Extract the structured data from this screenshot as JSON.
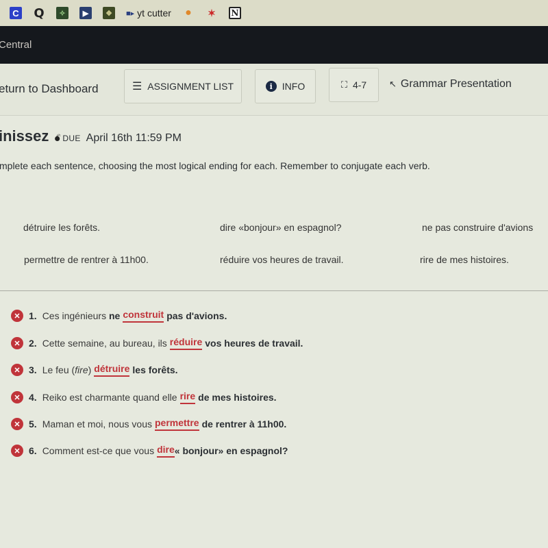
{
  "bookmarks": [
    {
      "icon": "c-app-icon",
      "glyph": "C"
    },
    {
      "icon": "q-app-icon",
      "glyph": "Q"
    },
    {
      "icon": "green-app-icon",
      "glyph": "✧"
    },
    {
      "icon": "play-app-icon",
      "glyph": "▶"
    },
    {
      "icon": "game-app-icon",
      "glyph": "❖"
    },
    {
      "icon": "yt-cutter-icon",
      "glyph": "■▸",
      "label": "yt cutter"
    },
    {
      "icon": "lightbulb-icon",
      "glyph": "●"
    },
    {
      "icon": "crossed-icon",
      "glyph": "✶"
    },
    {
      "icon": "notion-icon",
      "glyph": "N"
    }
  ],
  "app": {
    "title": "Central"
  },
  "toolbar": {
    "back_label": "eturn to Dashboard",
    "assignment_list_label": "ASSIGNMENT LIST",
    "info_label": "INFO",
    "book_label": "4-7",
    "grammar_label": "Grammar Presentation",
    "list_icon_glyph": "☰",
    "info_icon_glyph": "i",
    "book_icon_glyph": "⛶",
    "arrow_icon_glyph": "↖"
  },
  "assignment": {
    "title": "inissez",
    "due_label": "DUE",
    "due_date": "April 16th 11:59 PM",
    "instructions": "mplete each sentence, choosing the most logical ending for each. Remember to conjugate each verb."
  },
  "word_bank": [
    "détruire les forêts.",
    "dire «bonjour» en espagnol?",
    "ne pas construire d'avions",
    "permettre de rentrer à 11h00.",
    "réduire vos heures de travail.",
    "rire de mes histoires."
  ],
  "answers": [
    {
      "num": "1.",
      "pre": "Ces ingénieurs",
      "pre_bold": "ne",
      "answer": "construit",
      "post": "pas d'avions.",
      "status": "incorrect"
    },
    {
      "num": "2.",
      "pre": "Cette semaine, au bureau, ils",
      "pre_bold": "",
      "answer": "réduire",
      "post": "vos heures de travail.",
      "status": "incorrect"
    },
    {
      "num": "3.",
      "pre": "Le feu (",
      "pre_italic": "fire",
      "pre_end": ")",
      "answer": "détruire",
      "post": "les forêts.",
      "status": "incorrect"
    },
    {
      "num": "4.",
      "pre": "Reiko est charmante quand elle",
      "pre_bold": "",
      "answer": "rire",
      "post": "de mes histoires.",
      "status": "incorrect"
    },
    {
      "num": "5.",
      "pre": "Maman et moi, nous vous",
      "pre_bold": "",
      "answer": "permettre",
      "post": "de rentrer à 11h00.",
      "status": "incorrect"
    },
    {
      "num": "6.",
      "pre": "Comment est-ce que vous",
      "pre_bold": "",
      "answer": "dire",
      "post": "« bonjour» en espagnol?",
      "status": "incorrect"
    }
  ],
  "colors": {
    "incorrect": "#c0343a",
    "appbar": "#15181d"
  }
}
